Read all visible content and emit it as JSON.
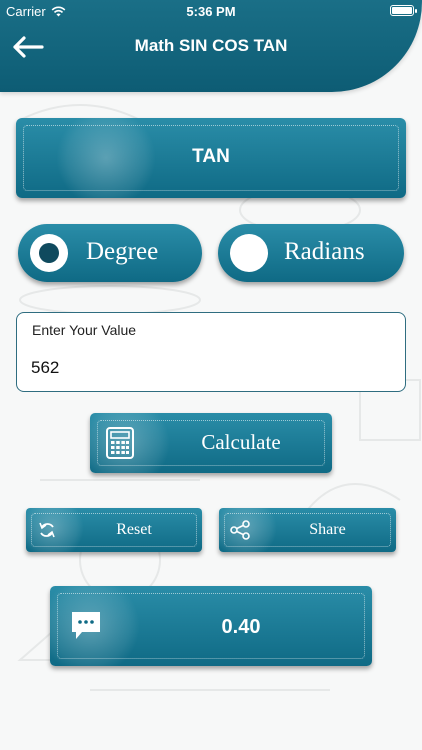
{
  "status": {
    "carrier": "Carrier",
    "time": "5:36 PM"
  },
  "header": {
    "title": "Math SIN COS TAN"
  },
  "function_button": {
    "label": "TAN"
  },
  "mode": {
    "degree_label": "Degree",
    "radians_label": "Radians",
    "selected": "Degree"
  },
  "input": {
    "label": "Enter Your Value",
    "value": "562"
  },
  "actions": {
    "calculate_label": "Calculate",
    "reset_label": "Reset",
    "share_label": "Share"
  },
  "result": {
    "value": "0.40"
  },
  "colors": {
    "primary": "#1a6f87",
    "button_top": "#2a8da8",
    "button_bottom": "#0f6a85",
    "background": "#f7f8f8"
  }
}
